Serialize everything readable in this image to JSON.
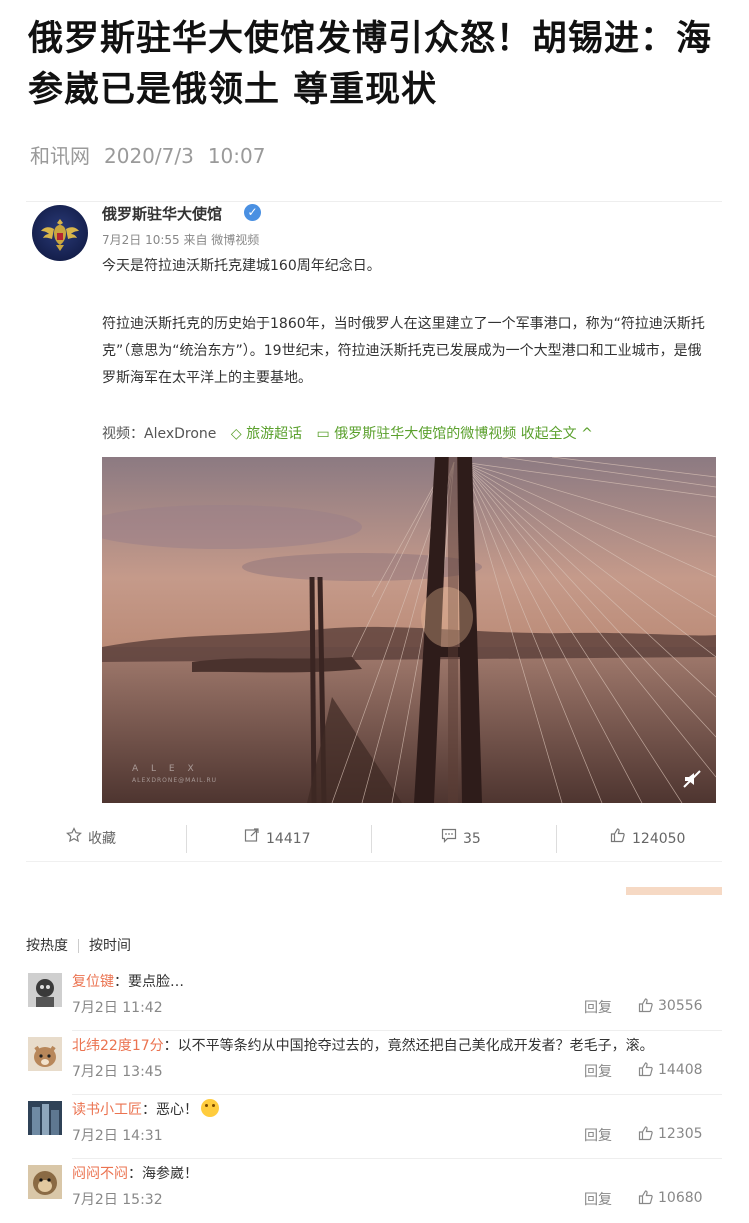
{
  "article": {
    "title": "俄罗斯驻华大使馆发博引众怒！胡锡进：海参崴已是俄领土 尊重现状",
    "source": "和讯网",
    "date": "2020/7/3",
    "time": "10:07"
  },
  "post": {
    "author": "俄罗斯驻华大使馆",
    "verified_icon": "verified-badge-icon",
    "date_line": "7月2日 10:55 来自 微博视频",
    "paragraph1": "今天是符拉迪沃斯托克建城160周年纪念日。",
    "paragraph2": "符拉迪沃斯托克的历史始于1860年，当时俄罗人在这里建立了一个军事港口，称为“符拉迪沃斯托克”（意思为“统治东方”）。19世纪末，符拉迪沃斯托克已发展成为一个大型港口和工业城市，是俄罗斯海军在太平洋上的主要基地。",
    "video_label": "视频：AlexDrone",
    "video_tag": "旅游超话",
    "video_source": "俄罗斯驻华大使馆的微博视频",
    "collapse_label": "收起全文",
    "collapse_icon": "^",
    "video_watermark": "A L E X",
    "video_watermark_sub": "ALEXDRONE@MAIL.RU",
    "colors": {
      "link_green": "#5aa02c",
      "name_orange": "#eb7350",
      "verified_blue": "#4a90e2"
    }
  },
  "actions": {
    "favorite_label": "收藏",
    "forward_count": "14417",
    "comment_count": "35",
    "like_count": "124050"
  },
  "sort": {
    "hot": "按热度",
    "time": "按时间"
  },
  "comments": [
    {
      "name": "复位键",
      "text": "：要点脸…",
      "time": "7月2日 11:42",
      "reply": "回复",
      "likes": "30556"
    },
    {
      "name": "北纬22度17分",
      "text": "：以不平等条约从中国抢夺过去的，竟然还把自己美化成开发者？老毛子，滚。",
      "time": "7月2日 13:45",
      "reply": "回复",
      "likes": "14408"
    },
    {
      "name": "读书小工匠",
      "text": "：恶心！",
      "time": "7月2日 14:31",
      "reply": "回复",
      "likes": "12305"
    },
    {
      "name": "闷闷不闷",
      "text": "：海参崴！",
      "time": "7月2日 15:32",
      "reply": "回复",
      "likes": "10680"
    }
  ]
}
